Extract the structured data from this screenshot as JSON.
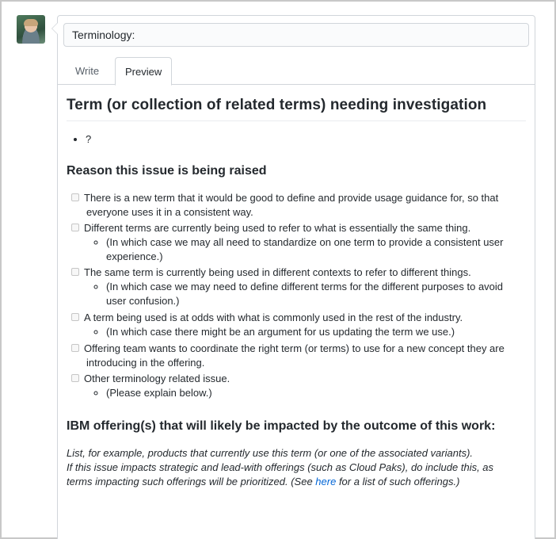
{
  "issue": {
    "title_value": "Terminology:"
  },
  "tabs": {
    "write": "Write",
    "preview": "Preview"
  },
  "preview": {
    "h_term": "Term (or collection of related terms) needing investigation",
    "term_bullet": "?",
    "h_reason": "Reason this issue is being raised",
    "reasons": [
      {
        "line1": "There is a new term that it would be good to define and provide usage guidance for, so that",
        "line2": "everyone uses it in a consistent way."
      },
      {
        "line1": "Different terms are currently being used to refer to what is essentially the same thing.",
        "sub1": "(In which case we may all need to standardize on one term to provide a consistent user",
        "sub2": "experience.)"
      },
      {
        "line1": "The same term is currently being used in different contexts to refer to different things.",
        "sub1": "(In which case we may need to define different terms for the different purposes to avoid",
        "sub2": "user confusion.)"
      },
      {
        "line1": "A term being used is at odds with what is commonly used in the rest of the industry.",
        "sub1": "(In which case there might be an argument for us updating the term we use.)"
      },
      {
        "line1": "Offering team wants to coordinate the right term (or terms) to use for a new concept they are",
        "line2": "introducing in the offering."
      },
      {
        "line1": "Other terminology related issue.",
        "sub1": "(Please explain below.)"
      }
    ],
    "h_offerings": "IBM offering(s) that will likely be impacted by the outcome of this work:",
    "note_line1": "List, for example, products that currently use this term (or one of the associated variants).",
    "note_line2": "If this issue impacts strategic and lead-with offerings (such as Cloud Paks), do include this, as",
    "note_line3_before": "terms impacting such offerings will be prioritized. (See ",
    "note_link": "here",
    "note_line3_after": " for a list of such offerings.)"
  }
}
